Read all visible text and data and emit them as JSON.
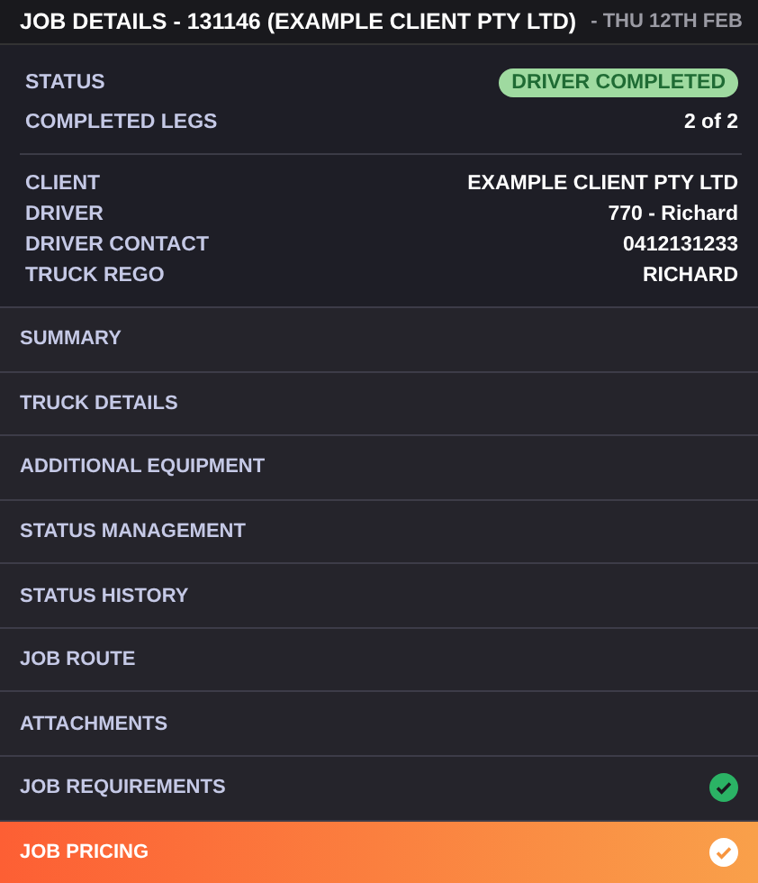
{
  "header": {
    "title": "JOB DETAILS - 131146 (EXAMPLE CLIENT PTY LTD)",
    "date": "- THU 12TH FEB"
  },
  "status": {
    "label": "STATUS",
    "badge": "DRIVER COMPLETED"
  },
  "legs": {
    "label": "COMPLETED LEGS",
    "value": "2 of 2"
  },
  "details": [
    {
      "label": "CLIENT",
      "value": "EXAMPLE CLIENT PTY LTD"
    },
    {
      "label": "DRIVER",
      "value": "770 - Richard"
    },
    {
      "label": "DRIVER CONTACT",
      "value": "0412131233"
    },
    {
      "label": "TRUCK REGO",
      "value": "RICHARD"
    }
  ],
  "sections": [
    {
      "label": "SUMMARY",
      "selected": false,
      "completed": false
    },
    {
      "label": "TRUCK DETAILS",
      "selected": false,
      "completed": false
    },
    {
      "label": "ADDITIONAL EQUIPMENT",
      "selected": false,
      "completed": false
    },
    {
      "label": "STATUS MANAGEMENT",
      "selected": false,
      "completed": false
    },
    {
      "label": "STATUS HISTORY",
      "selected": false,
      "completed": false
    },
    {
      "label": "JOB ROUTE",
      "selected": false,
      "completed": false
    },
    {
      "label": "ATTACHMENTS",
      "selected": false,
      "completed": false
    },
    {
      "label": "JOB REQUIREMENTS",
      "selected": false,
      "completed": true
    },
    {
      "label": "JOB PRICING",
      "selected": true,
      "completed": true
    }
  ]
}
